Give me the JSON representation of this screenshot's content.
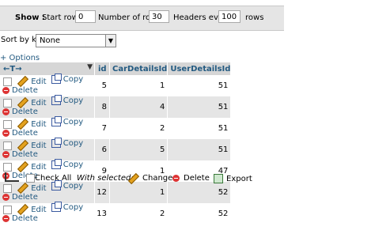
{
  "toolbar": {
    "show_label": "Show :",
    "start_row_label": "Start row:",
    "start_row_value": "0",
    "num_rows_label": "Number of rows:",
    "num_rows_value": "30",
    "headers_every_label": "Headers every",
    "headers_every_value": "100",
    "rows_label": "rows"
  },
  "sort": {
    "label": "Sort by key:",
    "value": "None"
  },
  "options_label": "+ Options",
  "columns": {
    "nav": "←T→",
    "id": "id",
    "car": "CarDetailsId",
    "user": "UserDetailsId"
  },
  "row_actions": {
    "edit": "Edit",
    "copy": "Copy",
    "delete": "Delete"
  },
  "rows": [
    {
      "id": "5",
      "car": "1",
      "user": "51"
    },
    {
      "id": "8",
      "car": "4",
      "user": "51"
    },
    {
      "id": "7",
      "car": "2",
      "user": "51"
    },
    {
      "id": "6",
      "car": "5",
      "user": "51"
    },
    {
      "id": "9",
      "car": "1",
      "user": "47"
    },
    {
      "id": "12",
      "car": "1",
      "user": "52"
    },
    {
      "id": "13",
      "car": "2",
      "user": "52"
    }
  ],
  "bottom": {
    "check_all": "Check All",
    "with_selected": "With selected:",
    "change": "Change",
    "delete": "Delete",
    "export": "Export"
  }
}
